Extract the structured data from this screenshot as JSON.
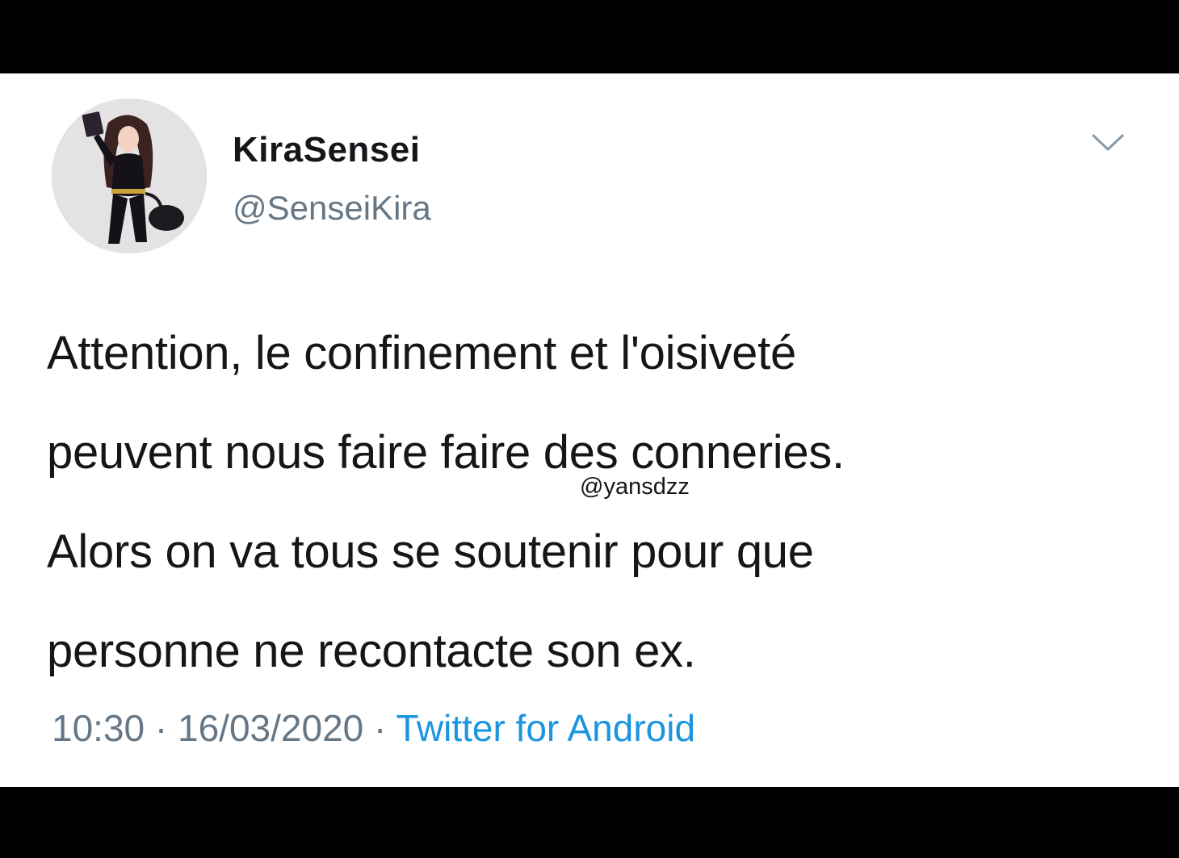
{
  "tweet": {
    "author": {
      "display_name": "KiraSensei",
      "handle": "@SenseiKira"
    },
    "lines": [
      "Attention, le confinement et l'oisiveté",
      "peuvent nous faire faire des conneries.",
      "Alors on va tous se soutenir pour que",
      "personne ne recontacte son ex."
    ],
    "time": "10:30",
    "separator": " · ",
    "date": "16/03/2020",
    "source": "Twitter for Android"
  },
  "watermark": "@yansdzz",
  "icons": {
    "menu": "chevron-down-icon"
  },
  "colors": {
    "background": "#ffffff",
    "frame": "#000000",
    "text": "#14171a",
    "secondary_text": "#657786",
    "link": "#1b95e0"
  }
}
